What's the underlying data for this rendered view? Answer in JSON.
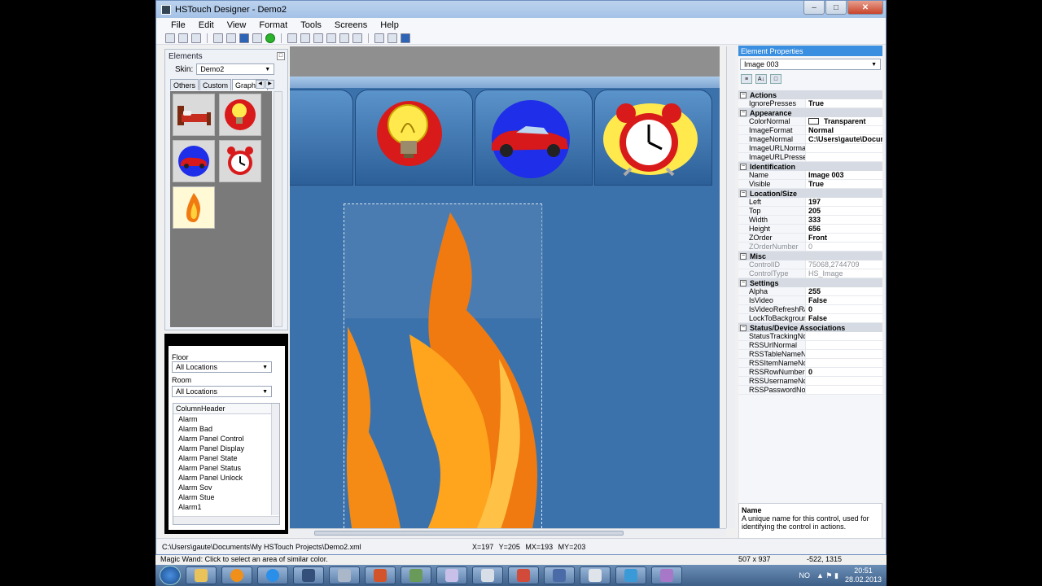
{
  "window": {
    "title": "HSTouch Designer - Demo2"
  },
  "menu": [
    "File",
    "Edit",
    "View",
    "Format",
    "Tools",
    "Screens",
    "Help"
  ],
  "elements_panel": {
    "title": "Elements",
    "skin_label": "Skin:",
    "skin_value": "Demo2",
    "tabs": [
      "Others",
      "Custom",
      "Graphics"
    ],
    "thumbnails": [
      "bed-icon",
      "bulb-icon",
      "car-icon",
      "alarm-clock-icon",
      "flame-icon"
    ]
  },
  "filter_panel": {
    "floor_label": "Floor",
    "floor_value": "All Locations",
    "room_label": "Room",
    "room_value": "All Locations",
    "list_header": "ColumnHeader",
    "items": [
      "Alarm",
      "Alarm Bad",
      "Alarm Panel Control",
      "Alarm Panel Display",
      "Alarm Panel State",
      "Alarm Panel Status",
      "Alarm Panel Unlock",
      "Alarm Sov",
      "Alarm Stue",
      "Alarm1"
    ]
  },
  "properties": {
    "title": "Element Properties",
    "selected": "Image 003",
    "categories": [
      {
        "name": "Actions",
        "rows": [
          [
            "IgnorePresses",
            "True"
          ]
        ]
      },
      {
        "name": "Appearance",
        "rows": [
          [
            "ColorNormal",
            "Transparent"
          ],
          [
            "ImageFormat",
            "Normal"
          ],
          [
            "ImageNormal",
            "C:\\Users\\gaute\\Docum"
          ],
          [
            "ImageURLNormal",
            ""
          ],
          [
            "ImageURLPressed",
            ""
          ]
        ]
      },
      {
        "name": "Identification",
        "rows": [
          [
            "Name",
            "Image 003"
          ],
          [
            "Visible",
            "True"
          ]
        ]
      },
      {
        "name": "Location/Size",
        "rows": [
          [
            "Left",
            "197"
          ],
          [
            "Top",
            "205"
          ],
          [
            "Width",
            "333"
          ],
          [
            "Height",
            "656"
          ],
          [
            "ZOrder",
            "Front"
          ],
          [
            "ZOrderNumber",
            "0"
          ]
        ]
      },
      {
        "name": "Misc",
        "rows": [
          [
            "ControlID",
            "75068,2744709"
          ],
          [
            "ControlType",
            "HS_Image"
          ]
        ]
      },
      {
        "name": "Settings",
        "rows": [
          [
            "Alpha",
            "255"
          ],
          [
            "IsVideo",
            "False"
          ],
          [
            "IsVideoRefreshRate",
            "0"
          ],
          [
            "LockToBackground",
            "False"
          ]
        ]
      },
      {
        "name": "Status/Device Associations",
        "rows": [
          [
            "StatusTrackingNorm",
            ""
          ],
          [
            "RSSUrlNormal",
            ""
          ],
          [
            "RSSTableNameNorm",
            ""
          ],
          [
            "RSSItemNameNorm",
            ""
          ],
          [
            "RSSRowNumberNo",
            "0"
          ],
          [
            "RSSUsernameNorm",
            ""
          ],
          [
            "RSSPasswordNorm",
            ""
          ]
        ]
      }
    ],
    "gray_rows": [
      "ZOrderNumber",
      "ControlID",
      "ControlType"
    ],
    "help_title": "Name",
    "help_text": "A unique name for this control, used for identifying the control in actions."
  },
  "status": {
    "path": "C:\\Users\\gaute\\Documents\\My HSTouch Projects\\Demo2.xml",
    "coords": "X=197   Y=205   MX=193   MY=203"
  },
  "hint": {
    "text": "Magic Wand: Click to select an area of similar color.",
    "size": "507 x 937",
    "pos": "-522, 1315"
  },
  "tray": {
    "lang": "NO",
    "time": "20:51",
    "date": "28.02.2013"
  },
  "colors": {
    "accent": "#3a8fe0",
    "screen_bg": "#3c72ab"
  }
}
